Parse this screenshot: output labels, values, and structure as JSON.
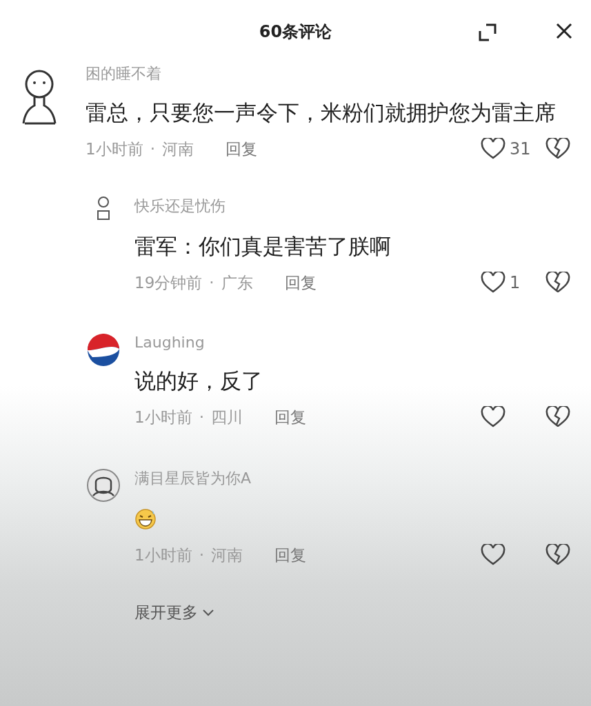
{
  "header": {
    "title": "60条评论"
  },
  "separator": "·",
  "comments": [
    {
      "kind": "top",
      "avatar": {
        "kind": "figure"
      },
      "user": "困的睡不着",
      "body": {
        "kind": "text",
        "text": "雷总，只要您一声令下，米粉们就拥护您为雷主席"
      },
      "time": "1小时前",
      "region": "河南",
      "reply": "回复",
      "likes": "31"
    },
    {
      "kind": "reply",
      "avatar": {
        "kind": "mini"
      },
      "user": "快乐还是忧伤",
      "body": {
        "kind": "text",
        "text": "雷军：你们真是害苦了朕啊"
      },
      "time": "19分钟前",
      "region": "广东",
      "reply": "回复",
      "likes": "1"
    },
    {
      "kind": "reply",
      "avatar": {
        "kind": "logo"
      },
      "user": "Laughing",
      "body": {
        "kind": "text",
        "text": "说的好，反了"
      },
      "time": "1小时前",
      "region": "四川",
      "reply": "回复"
    },
    {
      "kind": "reply",
      "avatar": {
        "kind": "sketch"
      },
      "user": "满目星辰皆为你A",
      "body": {
        "kind": "emoji"
      },
      "time": "1小时前",
      "region": "河南",
      "reply": "回复"
    }
  ],
  "expand": {
    "label": "展开更多"
  }
}
